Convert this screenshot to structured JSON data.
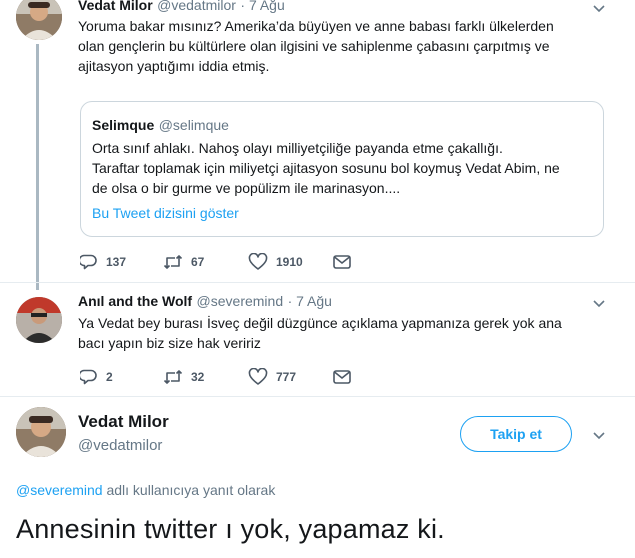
{
  "tweets": [
    {
      "name": "Vedat Milor",
      "handle": "@vedatmilor",
      "date": "· 7 Ağu",
      "text_lines": [
        "Yoruma bakar mısınız? Amerika’da büyüyen ve anne babası farklı ülkelerden",
        "olan gençlerin bu kültürlere olan ilgisini ve sahiplenme çabasını çarpıtmış ve",
        "ajitasyon yaptığımı iddia etmiş."
      ],
      "quote": {
        "name": "Selimque",
        "handle": "@selimque",
        "text_lines": [
          "Orta sınıf ahlakı. Nahoş olayı milliyetçiliğe payanda etme çakallığı.",
          "Taraftar toplamak için miliyetçi ajitasyon sosunu bol koymuş Vedat Abim, ne",
          "de olsa o bir gurme ve popülizm ile marinasyon...."
        ],
        "show_thread": "Bu Tweet dizisini göster"
      },
      "replies": "137",
      "retweets": "67",
      "likes": "1910"
    },
    {
      "name": "Anıl and the Wolf",
      "handle": "@severemind",
      "date": "· 7 Ağu",
      "text_lines": [
        "Ya Vedat bey burası İsveç değil düzgünce açıklama yapmanıza gerek yok ana",
        "bacı yapın biz size hak veririz"
      ],
      "replies": "2",
      "retweets": "32",
      "likes": "777"
    }
  ],
  "main_tweet": {
    "name": "Vedat Milor",
    "handle": "@vedatmilor",
    "follow_label": "Takip et",
    "reply_mention": "@severemind",
    "reply_suffix": " adlı kullanıcıya yanıt olarak",
    "text": "Annesinin twitter ı yok, yapamaz ki."
  },
  "colors": {
    "accent": "#1da1f2",
    "muted": "#657786",
    "thread_line": "#aab8c2"
  }
}
